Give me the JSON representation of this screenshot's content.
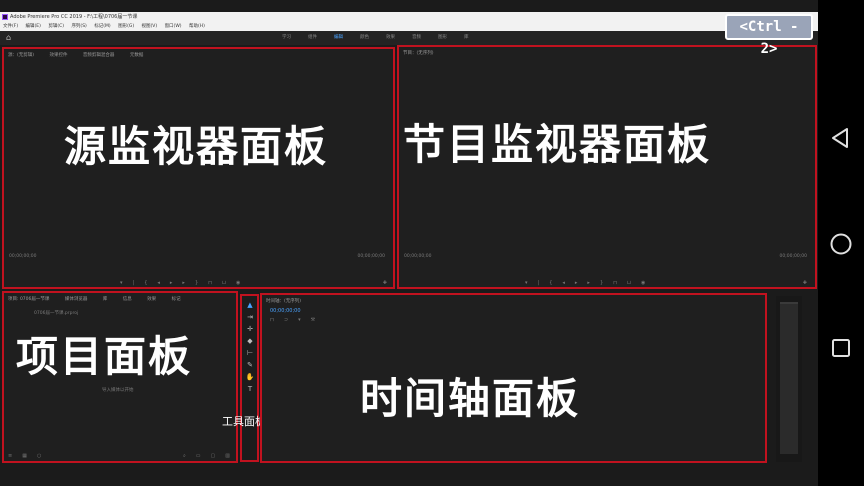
{
  "window": {
    "title": "Adobe Premiere Pro CC 2019 - F:\\工程\\0706届一节课",
    "menu": [
      "文件(F)",
      "编辑(E)",
      "剪辑(C)",
      "序列(S)",
      "标记(M)",
      "图形(G)",
      "视图(V)",
      "窗口(W)",
      "帮助(H)"
    ]
  },
  "workspaces": {
    "tabs": [
      "学习",
      "组件",
      "编辑",
      "颜色",
      "效果",
      "音频",
      "图形",
      "库"
    ],
    "active_index": 2
  },
  "shortcut_badge": "<Ctrl - 2>",
  "source_monitor": {
    "tabs": [
      "源：(无剪辑)",
      "效果控件",
      "音频剪辑混合器",
      "元数据"
    ],
    "label": "源监视器面板",
    "timecode_left": "00;00;00;00",
    "timecode_right": "00;00;00;00"
  },
  "program_monitor": {
    "tab": "节目：(无序列)",
    "label": "节目监视器面板",
    "timecode_left": "00;00;00;00",
    "timecode_right": "00;00;00;00"
  },
  "project_panel": {
    "tabs": [
      "项目: 0706届一节课",
      "媒体浏览器",
      "库",
      "信息",
      "效果",
      "标记"
    ],
    "file": "0706届一节课.prproj",
    "hint": "导入媒体以开始",
    "label": "项目面板"
  },
  "tools_panel": {
    "label": "工具面板",
    "tools": [
      "selection-tool",
      "track-select-tool",
      "ripple-edit-tool",
      "razor-tool",
      "slip-tool",
      "pen-tool",
      "hand-tool",
      "type-tool"
    ]
  },
  "timeline_panel": {
    "tab": "时间轴：(无序列)",
    "timecode": "00;00;00;00",
    "label": "时间轴面板"
  },
  "colors": {
    "highlight_border": "#c1121f",
    "active_workspace": "#4aa3ff"
  }
}
